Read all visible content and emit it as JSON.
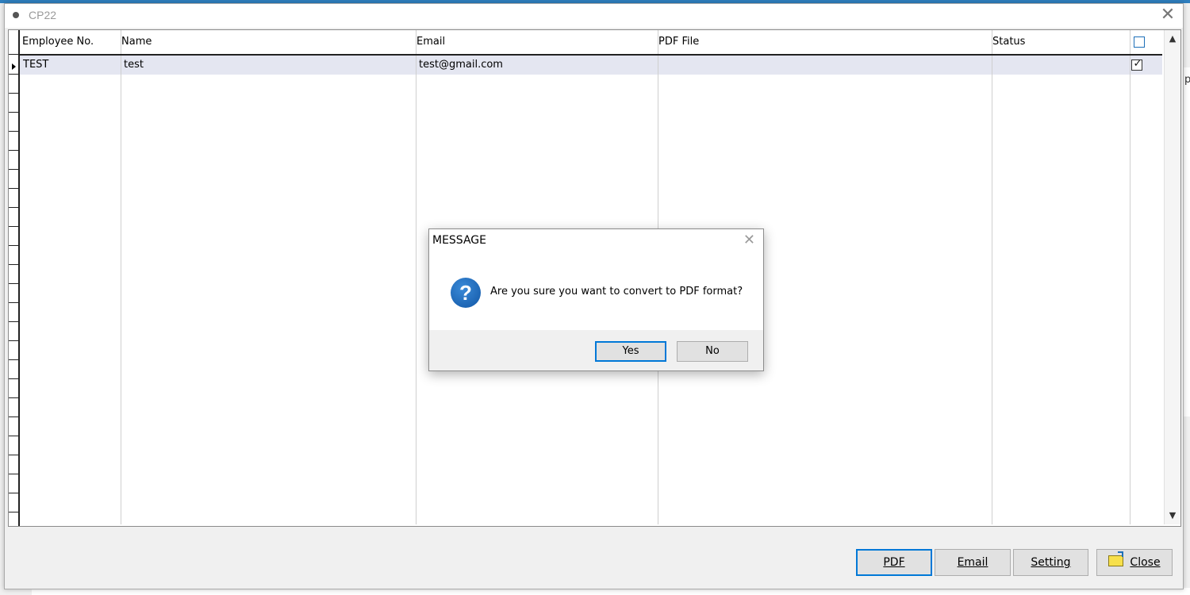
{
  "window": {
    "title": "CP22"
  },
  "grid": {
    "columns": [
      "Employee No.",
      "Name",
      "Email",
      "PDF File",
      "Status"
    ],
    "select_all_checked": false,
    "rows": [
      {
        "employee_no": "TEST",
        "name": "test",
        "email": "test@gmail.com",
        "pdf_file": "",
        "status": "",
        "selected": true
      }
    ]
  },
  "buttons": {
    "pdf": "PDF",
    "email": "Email",
    "setting": "Setting",
    "close": "Close"
  },
  "dialog": {
    "title": "MESSAGE",
    "icon": "question-icon",
    "message": "Are you sure you want to convert to PDF format?",
    "yes": "Yes",
    "no": "No"
  },
  "background": {
    "partial_text": "p"
  }
}
